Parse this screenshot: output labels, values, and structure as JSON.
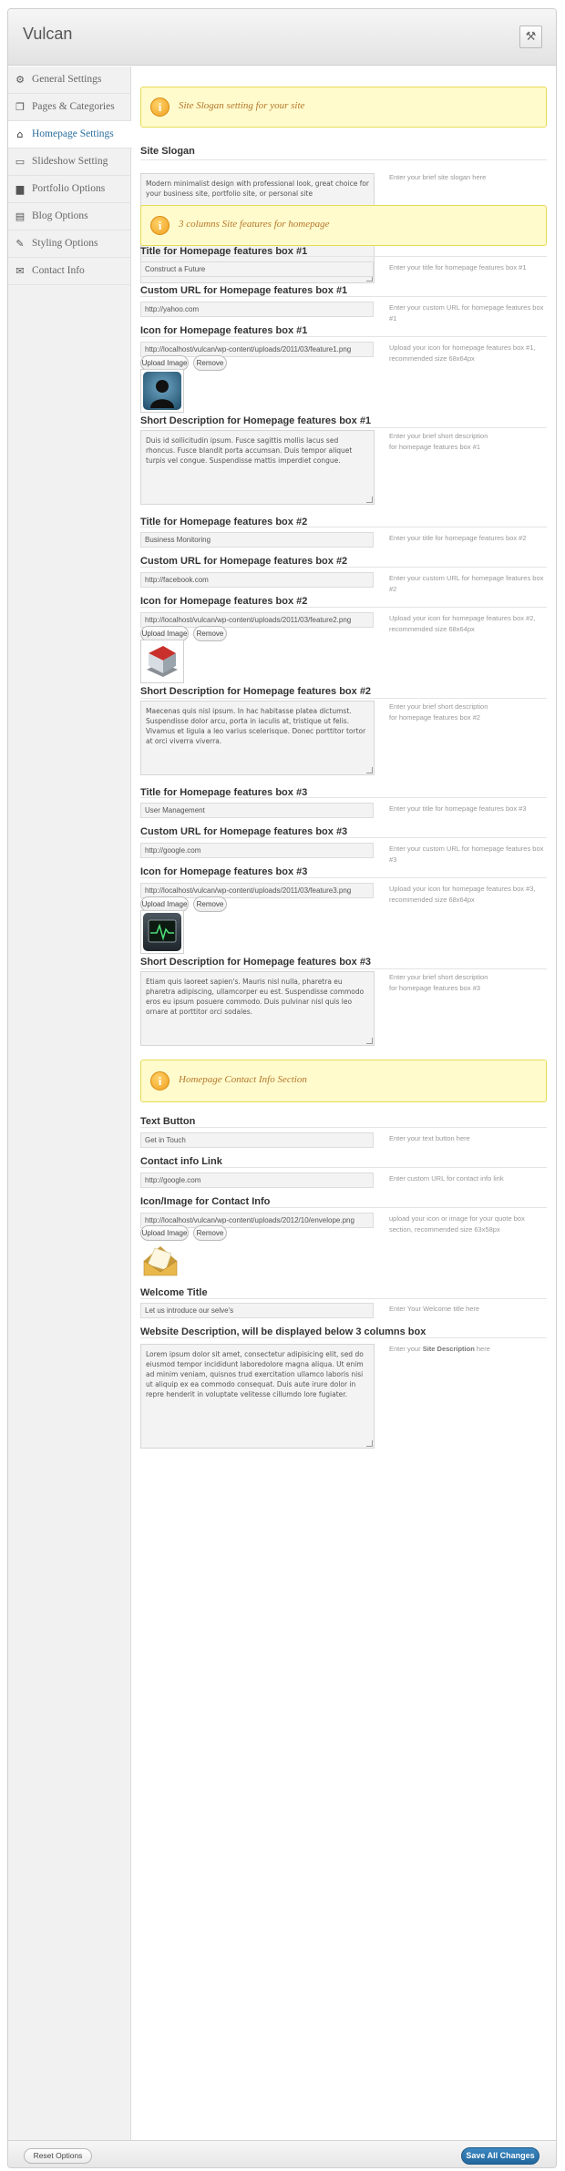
{
  "app": {
    "title": "Vulcan",
    "top_icon": "tools-icon"
  },
  "sidebar": {
    "items": [
      {
        "label": "General Settings",
        "icon": "gear-icon"
      },
      {
        "label": "Pages & Categories",
        "icon": "pages-icon"
      },
      {
        "label": "Homepage Settings",
        "icon": "home-icon",
        "active": true
      },
      {
        "label": "Slideshow Setting",
        "icon": "monitor-icon"
      },
      {
        "label": "Portfolio Options",
        "icon": "briefcase-icon"
      },
      {
        "label": "Blog Options",
        "icon": "document-icon"
      },
      {
        "label": "Styling Options",
        "icon": "brush-icon"
      },
      {
        "label": "Contact Info",
        "icon": "envelope-icon"
      }
    ]
  },
  "notices": {
    "slogan": "Site Slogan setting for your site",
    "features": "3 columns Site features for homepage",
    "contact": "Homepage Contact Info Section"
  },
  "slogan": {
    "title": "Site Slogan",
    "value": "Modern minimalist design with professional look, great choice for your business site, portfolio site, or personal site",
    "desc": "Enter your brief site slogan here"
  },
  "boxes": [
    {
      "title_label": "Title for Homepage features box #1",
      "title_value": "Construct a Future",
      "title_desc": "Enter your title for homepage features box #1",
      "url_label": "Custom URL for Homepage features box #1",
      "url_value": "http://yahoo.com",
      "url_desc": "Enter your custom URL for homepage features box #1",
      "icon_label": "Icon for Homepage features box #1",
      "icon_value": "http://localhost/vulcan/wp-content/uploads/2011/03/feature1.png",
      "icon_desc": "Upload your icon for homepage features box #1, recommended size 68x64px",
      "short_label": "Short Description for Homepage features box #1",
      "short_value": "Duis id sollicitudin ipsum. Fusce sagittis mollis lacus sed rhoncus. Fusce blandit porta accumsan. Duis tempor aliquet turpis vel congue. Suspendisse mattis imperdiet congue.",
      "short_desc": "Enter your brief short description for homepage features box #1"
    },
    {
      "title_label": "Title for Homepage features box #2",
      "title_value": "Business Monitoring",
      "title_desc": "Enter your title for homepage features box #2",
      "url_label": "Custom URL for Homepage features box #2",
      "url_value": "http://facebook.com",
      "url_desc": "Enter your custom URL for homepage features box #2",
      "icon_label": "Icon for Homepage features box #2",
      "icon_value": "http://localhost/vulcan/wp-content/uploads/2011/03/feature2.png",
      "icon_desc": "Upload your icon for homepage features box #2, recommended size 68x64px",
      "short_label": "Short Description for Homepage features box #2",
      "short_value": "Maecenas quis nisl ipsum. In hac habitasse platea dictumst. Suspendisse dolor arcu, porta in iaculis at, tristique ut felis. Vivamus et ligula a leo varius scelerisque. Donec porttitor tortor at orci viverra viverra.",
      "short_desc": "Enter your brief short description for homepage features box #2"
    },
    {
      "title_label": "Title for Homepage features box #3",
      "title_value": "User Management",
      "title_desc": "Enter your title for homepage features box #3",
      "url_label": "Custom URL for Homepage features box #3",
      "url_value": "http://google.com",
      "url_desc": "Enter your custom URL for homepage features box #3",
      "icon_label": "Icon for Homepage features box #3",
      "icon_value": "http://localhost/vulcan/wp-content/uploads/2011/03/feature3.png",
      "icon_desc": "Upload your icon for homepage features box #3, recommended size 68x64px",
      "short_label": "Short Description for Homepage features box #3",
      "short_value": "Etiam quis laoreet sapien's. Mauris nisl nulla, pharetra eu pharetra adipiscing, ullamcorper eu est. Suspendisse commodo eros eu ipsum posuere commodo. Duis pulvinar nisl quis leo ornare at porttitor orci sodales.",
      "short_desc": "Enter your brief short description for homepage features box #3"
    }
  ],
  "buttons": {
    "upload": "Upload Image",
    "remove": "Remove"
  },
  "contact": {
    "text_button_label": "Text Button",
    "text_button_value": "Get in Touch",
    "text_button_desc": "Enter your text button here",
    "link_label": "Contact info Link",
    "link_value": "http://google.com",
    "link_desc": "Enter custom URL for contact info link",
    "icon_label": "Icon/Image for Contact Info",
    "icon_value": "http://localhost/vulcan/wp-content/uploads/2012/10/envelope.png",
    "icon_desc": "upload your icon or image for your quote box section, recommended size 63x58px",
    "welcome_label": "Welcome Title",
    "welcome_value": "Let us introduce our selve's",
    "welcome_desc": "Enter Your Welcome title here",
    "website_label": "Website Description, will be displayed below 3 columns box",
    "website_value": "Lorem ipsum dolor sit amet, consectetur adipisicing elit, sed do eiusmod tempor incididunt laboredolore magna aliqua. Ut enim ad minim veniam, quisnos trud exercitation ullamco laboris nisi ut aliquip ex ea commodo consequat. Duis aute irure dolor in repre henderit in voluptate velitesse cillumdo lore fugiater.",
    "website_desc_pre": "Enter your ",
    "website_desc_bold": "Site Description",
    "website_desc_post": " here"
  },
  "footer": {
    "reset": "Reset Options",
    "save": "Save All Changes"
  }
}
